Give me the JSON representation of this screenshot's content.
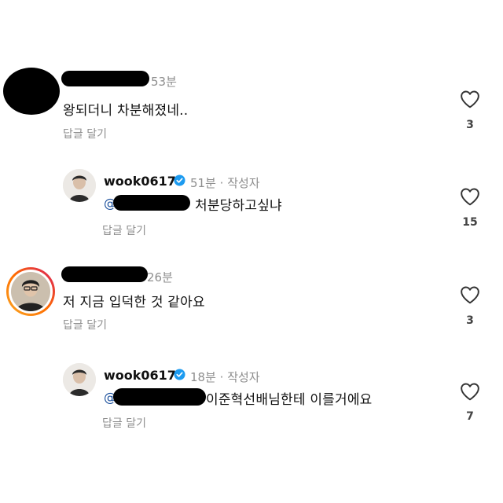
{
  "comments": [
    {
      "time": "53분",
      "text": "왕되더니 차분해졌네..",
      "reply_label": "답글 달기",
      "like_count": "3"
    },
    {
      "username": "wook0617",
      "time": "51분 · 작성자",
      "mention": "@",
      "text": "처분당하고싶냐",
      "reply_label": "답글 달기",
      "like_count": "15"
    },
    {
      "time": "26분",
      "text": "저 지금 입덕한 것 같아요",
      "reply_label": "답글 달기",
      "like_count": "3"
    },
    {
      "username": "wook0617",
      "time": "18분 · 작성자",
      "mention": "@",
      "text": "이준혁선배님한테 이를거에요",
      "reply_label": "답글 달기",
      "like_count": "7"
    }
  ],
  "colors": {
    "verified": "#1d9bf0",
    "mention": "#1a4f9c",
    "story_ring_start": "#f9a825",
    "story_ring_end": "#d81b60"
  },
  "icons": {
    "like": "heart-outline-icon",
    "verified": "verified-badge-icon"
  }
}
